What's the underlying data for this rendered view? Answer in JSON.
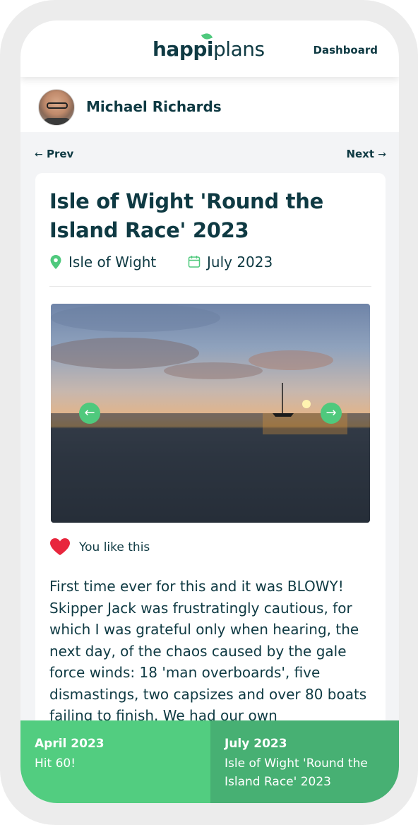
{
  "header": {
    "logo_part1": "happi",
    "logo_part2": "plans",
    "nav_link": "Dashboard"
  },
  "profile": {
    "name": "Michael Richards"
  },
  "pager": {
    "prev": "Prev",
    "next": "Next"
  },
  "entry": {
    "title": "Isle of Wight 'Round the Island Race' 2023",
    "location": "Isle of Wight",
    "date": "July 2023",
    "like_text": "You like this",
    "description": "First time ever for this and it was BLOWY! Skipper Jack was frustratingly cautious, for which I was grateful only when hearing, the next day, of the chaos caused by the gale force winds: 18 'man overboards', five dismastings, two capsizes and over 80 boats failing to finish. We had our own"
  },
  "timeline": {
    "previous": {
      "date": "April 2023",
      "title": "Hit 60!"
    },
    "current": {
      "date": "July 2023",
      "title": "Isle of Wight 'Round the Island Race' 2023"
    }
  },
  "icons": {
    "location": "map-pin-icon",
    "date": "calendar-icon",
    "like": "heart-icon",
    "carousel_prev": "arrow-left-icon",
    "carousel_next": "arrow-right-icon"
  },
  "colors": {
    "brand_green": "#4fc97d",
    "text_dark": "#0f3a43",
    "heart_red": "#e8263d",
    "timeline_left": "#52cd80",
    "timeline_right": "#47b073"
  }
}
